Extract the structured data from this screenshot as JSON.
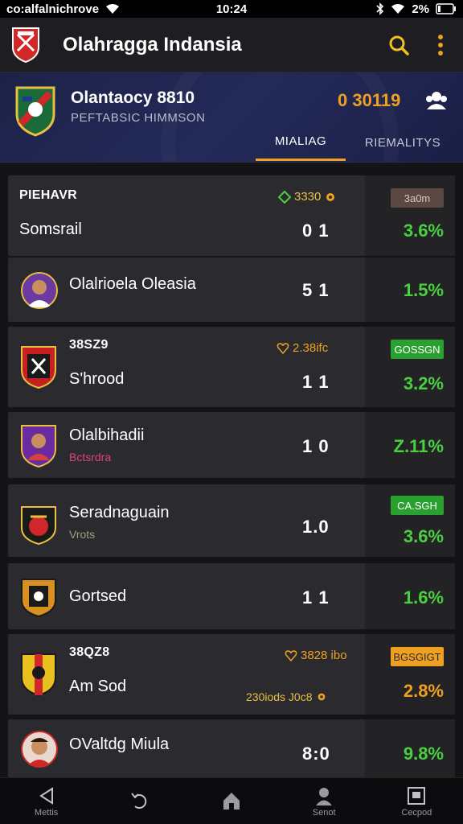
{
  "status_bar": {
    "left_text": "co:alfalnichrove",
    "time": "10:24",
    "battery": "2%"
  },
  "header": {
    "title": "Olahragga Indansia"
  },
  "hero": {
    "team": "Olantaocy  8810",
    "subtitle": "PEFTABSIC HIMMSON",
    "score": "0 30119",
    "tabs": [
      {
        "label": "MIALIAG"
      },
      {
        "label": "RIEMALITYS"
      }
    ]
  },
  "cards": [
    {
      "title": "PIEHAVR",
      "odds": "3330",
      "badge": "3a0m",
      "name": "Somsrail",
      "score": "0 1",
      "pct": "3.6%"
    },
    {
      "name": "Olalrioela Oleasia",
      "score": "5 1",
      "pct": "1.5%"
    },
    {
      "title": "38SZ9",
      "odds": "2.38ifc",
      "badge": "GOSSGN",
      "name": "S'hrood",
      "score": "1 1",
      "pct": "3.2%"
    },
    {
      "name": "Olalbihadii",
      "sub": "Bctsrdra",
      "score": "1 0",
      "pct": "Z.11%"
    },
    {
      "name": "Seradnaguain",
      "sub": "Vrots",
      "badge": "CA.SGH",
      "score": "1.0",
      "pct": "3.6%"
    },
    {
      "name": "Gortsed",
      "score": "1 1",
      "pct": "1.6%"
    },
    {
      "title": "38QZ8",
      "odds": "3828 ibo",
      "badge": "BGSGIGT",
      "name": "Am Sod",
      "extra": "230iods J0c8",
      "score": "",
      "pct": "2.8%"
    },
    {
      "name": "OValtdg Miula",
      "score": "8:0",
      "pct": "9.8%"
    }
  ],
  "bottom_nav": [
    {
      "label": "Mettis"
    },
    {
      "label": ""
    },
    {
      "label": ""
    },
    {
      "label": "Senot"
    },
    {
      "label": "Cecpod"
    }
  ]
}
